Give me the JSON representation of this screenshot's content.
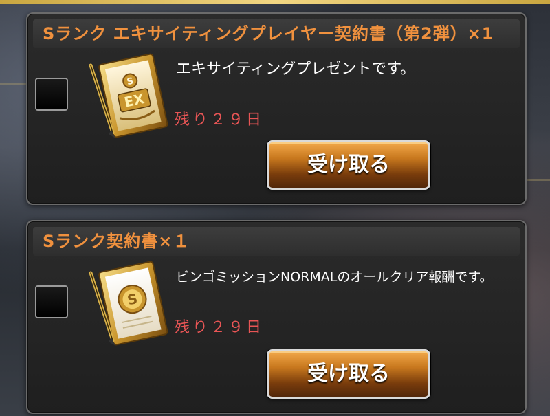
{
  "colors": {
    "title_text": "#f0913e",
    "remaining_text": "#e85555",
    "button_gradient_top": "#f3a94a",
    "button_gradient_bottom": "#52270a",
    "card_bg": "#1f1f1f",
    "frame_gold": "#d4a73a"
  },
  "items": [
    {
      "title": "Sランク エキサイティングプレイヤー契約書（第2弾）×1",
      "description": "エキサイティングプレゼントです。",
      "remaining": "残り２９日",
      "button_label": "受け取る",
      "icon": "ex-contract-icon",
      "checked": false
    },
    {
      "title": "Sランク契約書×１",
      "description": "ビンゴミッションNORMALのオールクリア報酬です。",
      "remaining": "残り２９日",
      "button_label": "受け取る",
      "icon": "s-contract-icon",
      "checked": false
    }
  ]
}
